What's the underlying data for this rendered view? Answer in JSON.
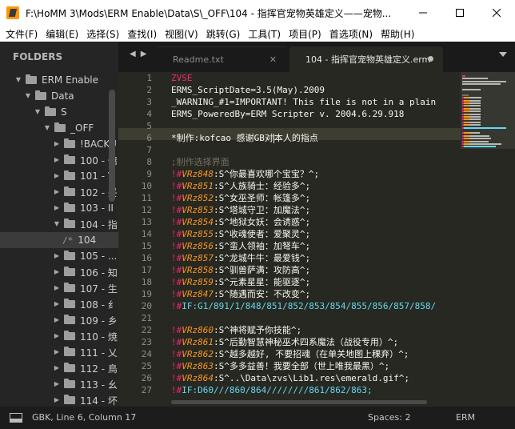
{
  "window": {
    "title": "F:\\HoMM 3\\Mods\\ERM Enable\\Data\\S\\_OFF\\104 - 指挥官宠物英雄定义——宠物..."
  },
  "menu": [
    "文件(F)",
    "编辑(E)",
    "选择(S)",
    "查找(I)",
    "视图(V)",
    "跳转(G)",
    "工具(T)",
    "项目(P)",
    "首选项(N)",
    "帮助(H)"
  ],
  "sidebar": {
    "header": "FOLDERS",
    "items": [
      {
        "label": "ERM Enable",
        "depth": 0,
        "type": "folder",
        "open": true
      },
      {
        "label": "Data",
        "depth": 1,
        "type": "folder",
        "open": true
      },
      {
        "label": "S",
        "depth": 2,
        "type": "folder",
        "open": true
      },
      {
        "label": "_OFF",
        "depth": 3,
        "type": "folder",
        "open": true
      },
      {
        "label": "!BACKU",
        "depth": 4,
        "type": "folder",
        "open": false
      },
      {
        "label": "100 - 傭",
        "depth": 4,
        "type": "folder",
        "open": false
      },
      {
        "label": "101 - V",
        "depth": 4,
        "type": "folder",
        "open": false
      },
      {
        "label": "102 - 妥",
        "depth": 4,
        "type": "folder",
        "open": false
      },
      {
        "label": "103 - II",
        "depth": 4,
        "type": "folder",
        "open": false
      },
      {
        "label": "104 - 指",
        "depth": 4,
        "type": "folder",
        "open": true
      },
      {
        "label": "104",
        "depth": 5,
        "type": "file",
        "selected": true
      },
      {
        "label": "105 - ...",
        "depth": 4,
        "type": "folder",
        "open": false
      },
      {
        "label": "106 - 知",
        "depth": 4,
        "type": "folder",
        "open": false
      },
      {
        "label": "107 - 生",
        "depth": 4,
        "type": "folder",
        "open": false
      },
      {
        "label": "108 - 纟",
        "depth": 4,
        "type": "folder",
        "open": false
      },
      {
        "label": "109 - 乡",
        "depth": 4,
        "type": "folder",
        "open": false
      },
      {
        "label": "110 - 焼",
        "depth": 4,
        "type": "folder",
        "open": false
      },
      {
        "label": "111 - 乂",
        "depth": 4,
        "type": "folder",
        "open": false
      },
      {
        "label": "112 - 鳥",
        "depth": 4,
        "type": "folder",
        "open": false
      },
      {
        "label": "113 - 幺",
        "depth": 4,
        "type": "folder",
        "open": false
      },
      {
        "label": "114 - 坏",
        "depth": 4,
        "type": "folder",
        "open": false
      }
    ]
  },
  "tabs": [
    {
      "label": "Readme.txt",
      "active": false
    },
    {
      "label": "104 - 指挥官宠物英雄定义.erm",
      "active": true
    }
  ],
  "editor": {
    "line_numbers": [
      "1",
      "2",
      "3",
      "4",
      "5",
      "6",
      "7",
      "8",
      "9",
      "10",
      "11",
      "12",
      "13",
      "14",
      "15",
      "16",
      "17",
      "18",
      "19",
      "20",
      "21",
      "22",
      "23",
      "24",
      "25",
      "26",
      "27"
    ],
    "lines": [
      [
        {
          "t": "ZVSE",
          "c": "red"
        }
      ],
      [
        {
          "t": "ERMS_ScriptDate=3.5(May).2009",
          "c": "white"
        }
      ],
      [
        {
          "t": "_WARNING_#1=IMPORTANT! This file is not in a plain",
          "c": "white"
        }
      ],
      [
        {
          "t": "ERMS_PoweredBy=ERM Scripter v. 2004.6.29.918",
          "c": "white"
        }
      ],
      [],
      [
        {
          "t": "*制作:kofcao 感谢GB对",
          "c": "white"
        },
        {
          "cursor": true
        },
        {
          "t": "本人的指点",
          "c": "white"
        }
      ],
      [],
      [
        {
          "t": ";制作选择界面",
          "c": "comment"
        }
      ],
      [
        {
          "t": "!#",
          "c": "red"
        },
        {
          "t": "VRz848",
          "c": "var"
        },
        {
          "t": ":S^你最喜欢哪个宝宝？^;",
          "c": "white"
        }
      ],
      [
        {
          "t": "!#",
          "c": "red"
        },
        {
          "t": "VRz851",
          "c": "var"
        },
        {
          "t": ":S^人族骑士：经验多^;",
          "c": "white"
        }
      ],
      [
        {
          "t": "!#",
          "c": "red"
        },
        {
          "t": "VRz852",
          "c": "var"
        },
        {
          "t": ":S^女巫圣师：帐篷多^;",
          "c": "white"
        }
      ],
      [
        {
          "t": "!#",
          "c": "red"
        },
        {
          "t": "VRz853",
          "c": "var"
        },
        {
          "t": ":S^塔城守卫：加魔法^;",
          "c": "white"
        }
      ],
      [
        {
          "t": "!#",
          "c": "red"
        },
        {
          "t": "VRz854",
          "c": "var"
        },
        {
          "t": ":S^地狱女妖：会诱惑^;",
          "c": "white"
        }
      ],
      [
        {
          "t": "!#",
          "c": "red"
        },
        {
          "t": "VRz855",
          "c": "var"
        },
        {
          "t": ":S^收魂使者：爱聚灵^;",
          "c": "white"
        }
      ],
      [
        {
          "t": "!#",
          "c": "red"
        },
        {
          "t": "VRz856",
          "c": "var"
        },
        {
          "t": ":S^蛮人领袖：加弩车^;",
          "c": "white"
        }
      ],
      [
        {
          "t": "!#",
          "c": "red"
        },
        {
          "t": "VRz857",
          "c": "var"
        },
        {
          "t": ":S^龙城牛牛：最爱钱^;",
          "c": "white"
        }
      ],
      [
        {
          "t": "!#",
          "c": "red"
        },
        {
          "t": "VRz858",
          "c": "var"
        },
        {
          "t": ":S^驯兽萨满：攻防高^;",
          "c": "white"
        }
      ],
      [
        {
          "t": "!#",
          "c": "red"
        },
        {
          "t": "VRz859",
          "c": "var"
        },
        {
          "t": ":S^元素星星：能驱逐^;",
          "c": "white"
        }
      ],
      [
        {
          "t": "!#",
          "c": "red"
        },
        {
          "t": "VRz847",
          "c": "var"
        },
        {
          "t": ":S^随遇而安：不改变^;",
          "c": "white"
        }
      ],
      [
        {
          "t": "!#",
          "c": "red"
        },
        {
          "t": "IF",
          "c": "cyan"
        },
        {
          "t": ":G1/891/1/848/851/852/853/854/855/856/857/858/",
          "c": "cyan"
        }
      ],
      [],
      [
        {
          "t": "!#",
          "c": "red"
        },
        {
          "t": "VRz860",
          "c": "var"
        },
        {
          "t": ":S^神将赋予你技能^;",
          "c": "white"
        }
      ],
      [
        {
          "t": "!#",
          "c": "red"
        },
        {
          "t": "VRz861",
          "c": "var"
        },
        {
          "t": ":S^后勤智慧神秘巫术四系魔法（战役专用）^;",
          "c": "white"
        }
      ],
      [
        {
          "t": "!#",
          "c": "red"
        },
        {
          "t": "VRz862",
          "c": "var"
        },
        {
          "t": ":S^越多越好, 不要招魂（在单关地图上稞弃）^;",
          "c": "white"
        }
      ],
      [
        {
          "t": "!#",
          "c": "red"
        },
        {
          "t": "VRz863",
          "c": "var"
        },
        {
          "t": ":S^多多益善！我要全部（世上唯我最黑）^;",
          "c": "white"
        }
      ],
      [
        {
          "t": "!#",
          "c": "red"
        },
        {
          "t": "VRz864",
          "c": "var"
        },
        {
          "t": ":S^..\\Data\\zvs\\Lib1.res\\emerald.gif^;",
          "c": "white"
        }
      ],
      [
        {
          "t": "!#",
          "c": "red"
        },
        {
          "t": "IF",
          "c": "cyan"
        },
        {
          "t": ":D60///860/864////////861/862/863;",
          "c": "cyan"
        }
      ]
    ]
  },
  "status": {
    "position": "GBK, Line 6, Column 17",
    "spaces": "Spaces: 2",
    "syntax": "ERM"
  },
  "icons": {
    "app": "sublime-text-icon",
    "minimize": "minimize-icon",
    "maximize": "maximize-icon",
    "close": "close-icon"
  }
}
